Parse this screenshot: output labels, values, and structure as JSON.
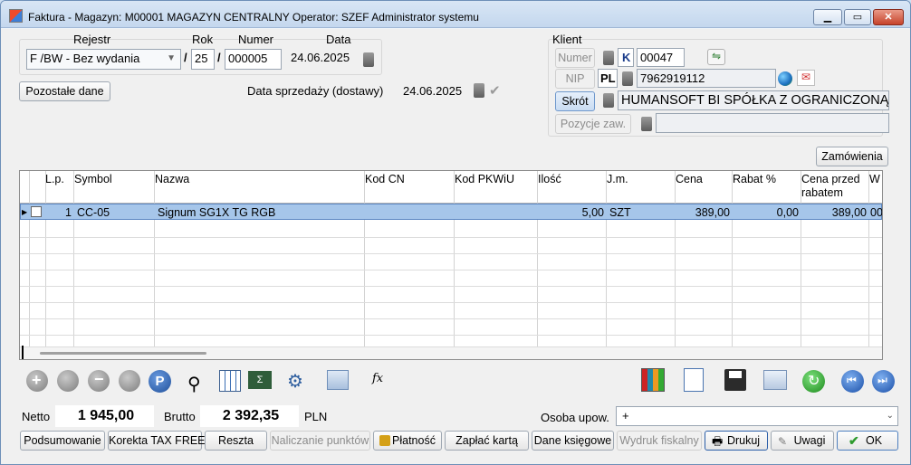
{
  "window": {
    "title": "Faktura - Magazyn: M00001 MAGAZYN CENTRALNY  Operator: SZEF Administrator systemu"
  },
  "header": {
    "rejestr_label": "Rejestr",
    "rok_label": "Rok",
    "numer_label": "Numer",
    "data_label": "Data",
    "rejestr_value": "F /BW - Bez wydania",
    "rok_value": "25",
    "numer_value": "000005",
    "data_value": "24.06.2025",
    "sep1": "/",
    "sep2": "/",
    "pozostale_button": "Pozostałe dane",
    "data_sprzedazy_label": "Data sprzedaży (dostawy)",
    "data_sprzedazy_value": "24.06.2025"
  },
  "client": {
    "group_label": "Klient",
    "numer_btn": "Numer",
    "numer_type": "K",
    "numer_value": "00047",
    "nip_btn": "NIP",
    "nip_prefix": "PL",
    "nip_value": "7962919112",
    "skrot_btn": "Skrót",
    "skrot_value": "HUMANSOFT BI SPÓŁKA Z OGRANICZONĄ",
    "pozycje_btn": "Pozycje zaw.",
    "pozycje_value": ""
  },
  "zamowienia_button": "Zamówienia",
  "grid": {
    "columns": [
      "L.p.",
      "Symbol",
      "Nazwa",
      "Kod CN",
      "Kod PKWiU",
      "Ilość",
      "J.m.",
      "Cena",
      "Rabat %",
      "Cena przed rabatem",
      "W"
    ],
    "rows": [
      {
        "lp": "1",
        "symbol": "CC-05",
        "nazwa": "Signum SG1X TG RGB",
        "kod_cn": "",
        "kod_pkwiu": "",
        "ilosc": "5,00",
        "jm": "SZT",
        "cena": "389,00",
        "rabat": "0,00",
        "cena_przed": "389,00",
        "w": "00"
      }
    ]
  },
  "totals": {
    "netto_label": "Netto",
    "netto_value": "1 945,00",
    "brutto_label": "Brutto",
    "brutto_value": "2 392,35",
    "currency": "PLN",
    "osoba_label": "Osoba upow.",
    "osoba_value": "+"
  },
  "buttons": {
    "podsumowanie": "Podsumowanie",
    "korekta": "Korekta TAX FREE",
    "reszta": "Reszta",
    "naliczanie": "Naliczanie punktów",
    "platnosc": "Płatność",
    "zaplac": "Zapłać kartą",
    "dane_ksiegowe": "Dane księgowe",
    "wydruk": "Wydruk fiskalny",
    "drukuj": "Drukuj",
    "uwagi": "Uwagi",
    "ok": "OK"
  },
  "colors": {
    "selection": "#a6c6ea",
    "accent_blue": "#2b5ea8",
    "ok_green": "#2e9b2e"
  }
}
